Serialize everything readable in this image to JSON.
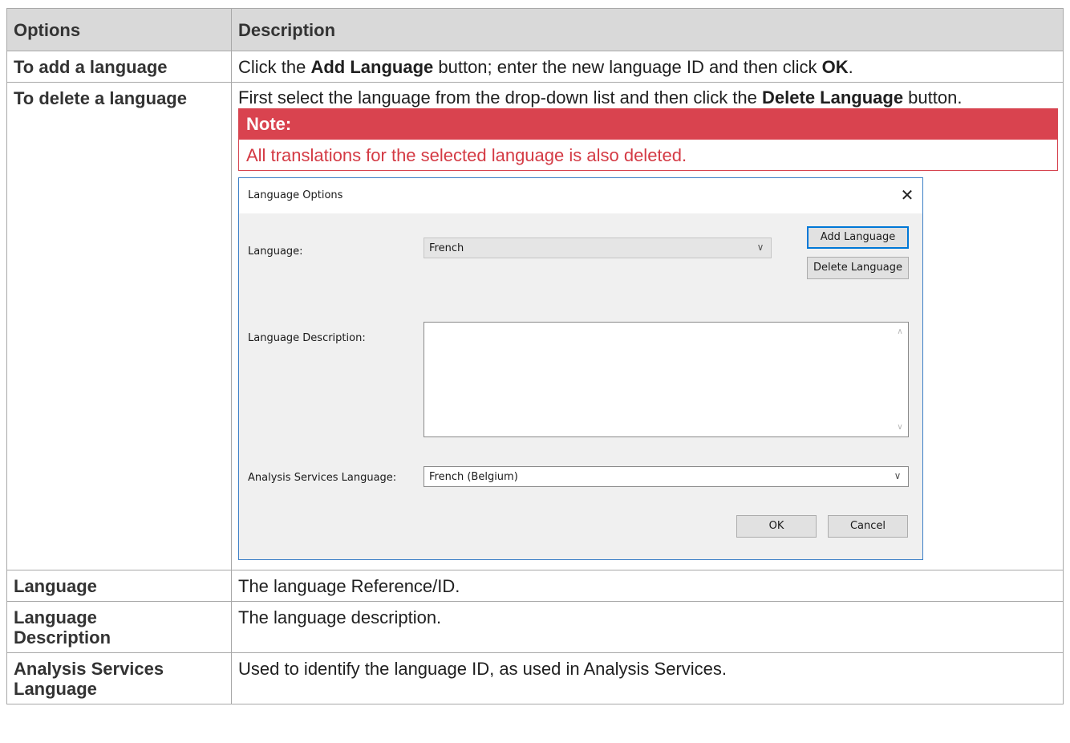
{
  "table": {
    "headers": [
      "Options",
      "Description"
    ],
    "rows": {
      "add": {
        "option": "To add a language",
        "desc": {
          "t1": "Click the ",
          "b1": "Add Language",
          "t2": " button; enter the new language ID and then click ",
          "b2": "OK",
          "t3": "."
        }
      },
      "delete": {
        "option": "To delete a language",
        "desc": {
          "t1": "First select the language from the drop-down list and then click the ",
          "b1": "Delete Language",
          "t2": " button."
        },
        "note": {
          "title": "Note:",
          "text": "All translations for the selected language is also deleted."
        }
      },
      "language": {
        "option": "Language",
        "desc": "The language Reference/ID."
      },
      "language_description": {
        "option_line1": "Language",
        "option_line2": "Description",
        "desc": "The language description."
      },
      "analysis": {
        "option_line1": "Analysis Services",
        "option_line2": "Language",
        "desc": "Used to identify the language ID, as used in Analysis Services."
      }
    }
  },
  "dialog": {
    "title": "Language Options",
    "close_glyph": "✕",
    "language_label": "Language:",
    "language_value": "French",
    "add_language_button": "Add Language",
    "delete_language_button": "Delete Language",
    "description_label": "Language Description:",
    "description_value": "",
    "analysis_label": "Analysis Services Language:",
    "analysis_value": "French (Belgium)",
    "ok_button": "OK",
    "cancel_button": "Cancel",
    "chevron_glyph": "∨",
    "scroll_up_glyph": "∧",
    "scroll_down_glyph": "∨"
  }
}
